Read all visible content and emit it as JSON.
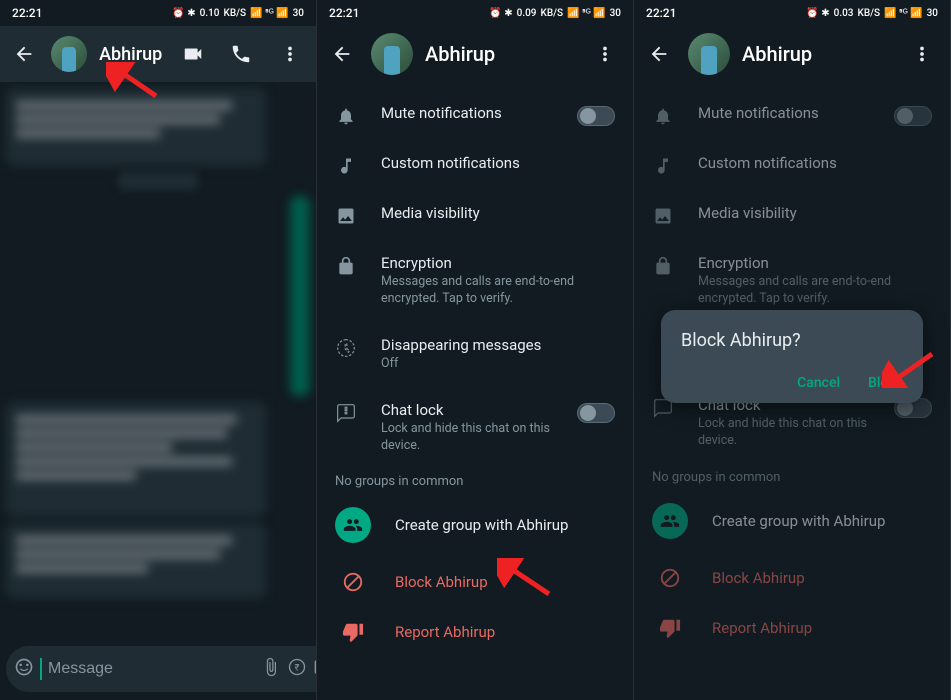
{
  "status": {
    "time": "22:21",
    "net1": "0.10",
    "net2": "0.09",
    "net3": "0.03",
    "net_unit": "KB/S",
    "battery": "30"
  },
  "contact": "Abhirup",
  "compose": {
    "placeholder": "Message"
  },
  "settings": {
    "mute": "Mute notifications",
    "custom": "Custom notifications",
    "media": "Media visibility",
    "encryption": "Encryption",
    "encryption_sub": "Messages and calls are end-to-end encrypted. Tap to verify.",
    "disappearing": "Disappearing messages",
    "disappearing_sub": "Off",
    "chatlock": "Chat lock",
    "chatlock_sub": "Lock and hide this chat on this device.",
    "no_groups": "No groups in common",
    "create_group": "Create group with Abhirup",
    "block": "Block Abhirup",
    "report": "Report Abhirup"
  },
  "dialog": {
    "title": "Block Abhirup?",
    "cancel": "Cancel",
    "confirm": "Block"
  }
}
